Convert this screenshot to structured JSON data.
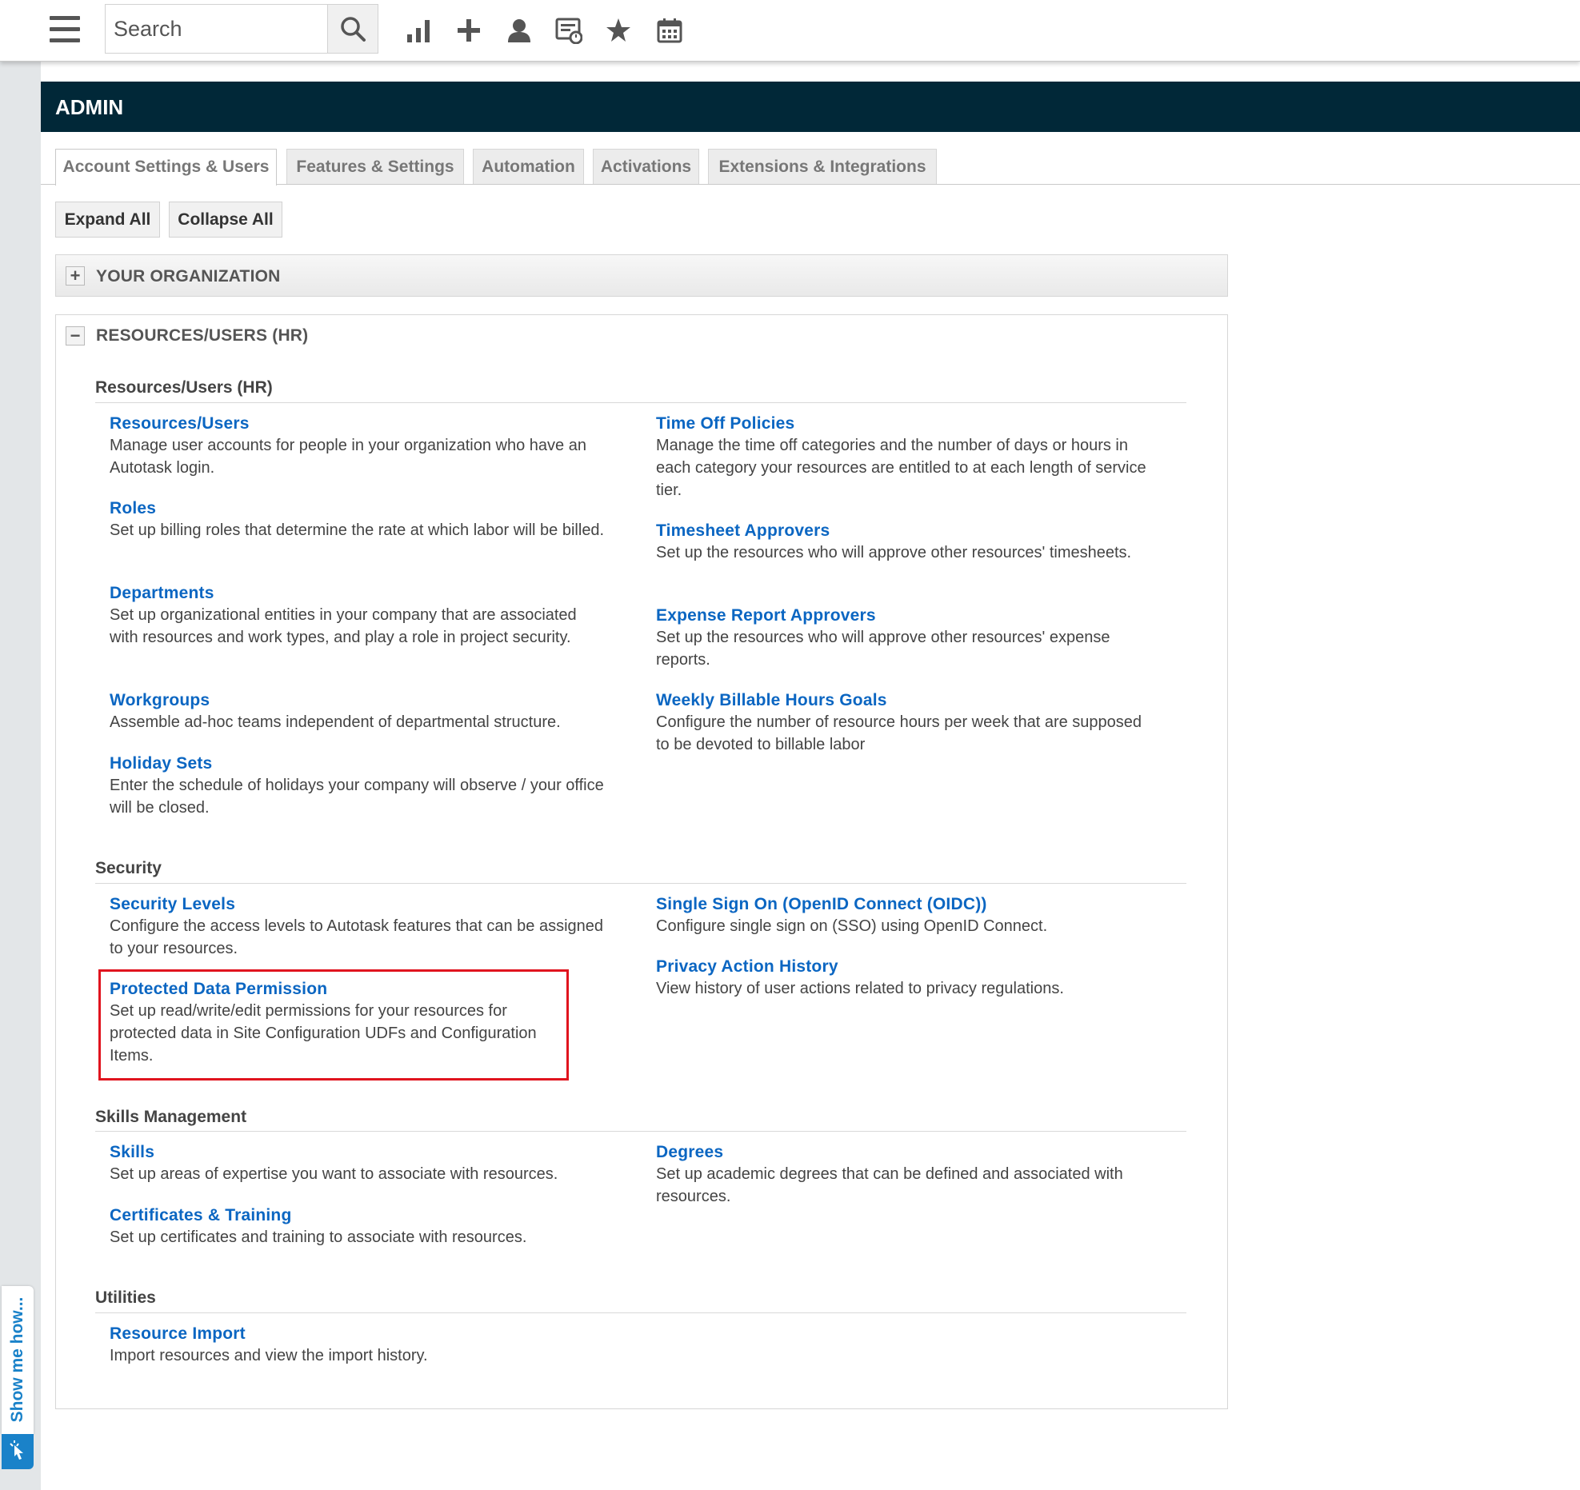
{
  "toolbar": {
    "search_placeholder": "Search",
    "icons": [
      "menu-icon",
      "search-icon",
      "chart-icon",
      "plus-icon",
      "user-icon",
      "timesheet-icon",
      "star-icon",
      "calendar-icon"
    ]
  },
  "sidebar": {
    "show_me_label": "Show me how..."
  },
  "header": {
    "title": "ADMIN"
  },
  "tabs": [
    {
      "label": "Account Settings & Users",
      "active": true
    },
    {
      "label": "Features & Settings"
    },
    {
      "label": "Automation"
    },
    {
      "label": "Activations"
    },
    {
      "label": "Extensions & Integrations"
    }
  ],
  "actions": {
    "expand_all": "Expand All",
    "collapse_all": "Collapse All"
  },
  "sections": {
    "your_org": {
      "title": "YOUR ORGANIZATION",
      "toggle": "+"
    },
    "resources": {
      "title": "RESOURCES/USERS (HR)",
      "toggle": "−"
    }
  },
  "groups": {
    "hr": {
      "heading": "Resources/Users (HR)",
      "items": [
        {
          "title": "Resources/Users",
          "desc": "Manage user accounts for people in your organization who have an Autotask login."
        },
        {
          "title": "Roles",
          "desc": "Set up billing roles that determine the rate at which labor will be billed."
        },
        {
          "title": "Departments",
          "desc": "Set up organizational entities in your company that are associated with resources and work types, and play a role in project security."
        },
        {
          "title": "Workgroups",
          "desc": "Assemble ad-hoc teams independent of departmental structure."
        },
        {
          "title": "Holiday Sets",
          "desc": "Enter the schedule of holidays your company will observe / your office will be closed."
        },
        {
          "title": "Time Off Policies",
          "desc": "Manage the time off categories and the number of days or hours in each category your resources are entitled to at each length of service tier."
        },
        {
          "title": "Timesheet Approvers",
          "desc": "Set up the resources who will approve other resources' timesheets."
        },
        {
          "title": "Expense Report Approvers",
          "desc": "Set up the resources who will approve other resources' expense reports."
        },
        {
          "title": "Weekly Billable Hours Goals",
          "desc": "Configure the number of resource hours per week that are supposed to be devoted to billable labor"
        }
      ]
    },
    "security": {
      "heading": "Security",
      "items": [
        {
          "title": "Security Levels",
          "desc": "Configure the access levels to Autotask features that can be assigned to your resources."
        },
        {
          "title": "Protected Data Permission",
          "desc": "Set up read/write/edit permissions for your resources for protected data in Site Configuration UDFs and Configuration Items."
        },
        {
          "title": "Single Sign On (OpenID Connect (OIDC))",
          "desc": "Configure single sign on (SSO) using OpenID Connect."
        },
        {
          "title": "Privacy Action History",
          "desc": "View history of user actions related to privacy regulations."
        }
      ]
    },
    "skills": {
      "heading": "Skills Management",
      "items": [
        {
          "title": "Skills",
          "desc": "Set up areas of expertise you want to associate with resources."
        },
        {
          "title": "Certificates & Training",
          "desc": "Set up certificates and training to associate with resources."
        },
        {
          "title": "Degrees",
          "desc": "Set up academic degrees that can be defined and associated with resources."
        }
      ]
    },
    "utilities": {
      "heading": "Utilities",
      "items": [
        {
          "title": "Resource Import",
          "desc": "Import resources and view the import history."
        }
      ]
    }
  },
  "colors": {
    "header_bg": "#012838",
    "link": "#0b66c2",
    "highlight": "#e0141e",
    "show_me": "#1a82c9"
  }
}
